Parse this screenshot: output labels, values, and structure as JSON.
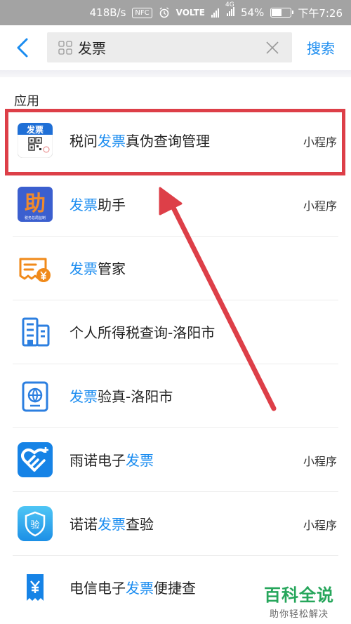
{
  "status_bar": {
    "speed": "418B/s",
    "nfc": "NFC",
    "volte": "VOLTE",
    "network": "4G",
    "battery_text": "54%",
    "battery_level": 0.54,
    "time": "下午7:26"
  },
  "header": {
    "query": "发票",
    "search_label": "搜索"
  },
  "section_title": "应用",
  "items": [
    {
      "pre": "税问",
      "hl": "发票",
      "post": "真伪查询管理",
      "tag": "小程序",
      "icon": "fapiao-qrcode-icon",
      "icon_text": "发票"
    },
    {
      "pre": "",
      "hl": "发票",
      "post": "助手",
      "tag": "小程序",
      "icon": "zhu-tax-bureau-icon",
      "icon_text": "助",
      "icon_subtext": "税务总局监制"
    },
    {
      "pre": "",
      "hl": "发票",
      "post": "管家",
      "tag": "",
      "icon": "invoice-yuan-icon"
    },
    {
      "pre": "个人所得税查询-洛阳市",
      "hl": "",
      "post": "",
      "tag": "",
      "icon": "building-icon"
    },
    {
      "pre": "",
      "hl": "发票",
      "post": "验真-洛阳市",
      "tag": "",
      "icon": "globe-passport-icon"
    },
    {
      "pre": "雨诺电子",
      "hl": "发票",
      "post": "",
      "tag": "小程序",
      "icon": "heart-plus-icon"
    },
    {
      "pre": "诺诺",
      "hl": "发票",
      "post": "查验",
      "tag": "小程序",
      "icon": "shield-verify-icon",
      "icon_text": "验"
    },
    {
      "pre": "电信电子",
      "hl": "发票",
      "post": "便捷查",
      "tag": "",
      "icon": "ticket-yuan-icon"
    }
  ],
  "watermark": {
    "title": "百科全说",
    "subtitle": "助你轻松解决"
  }
}
